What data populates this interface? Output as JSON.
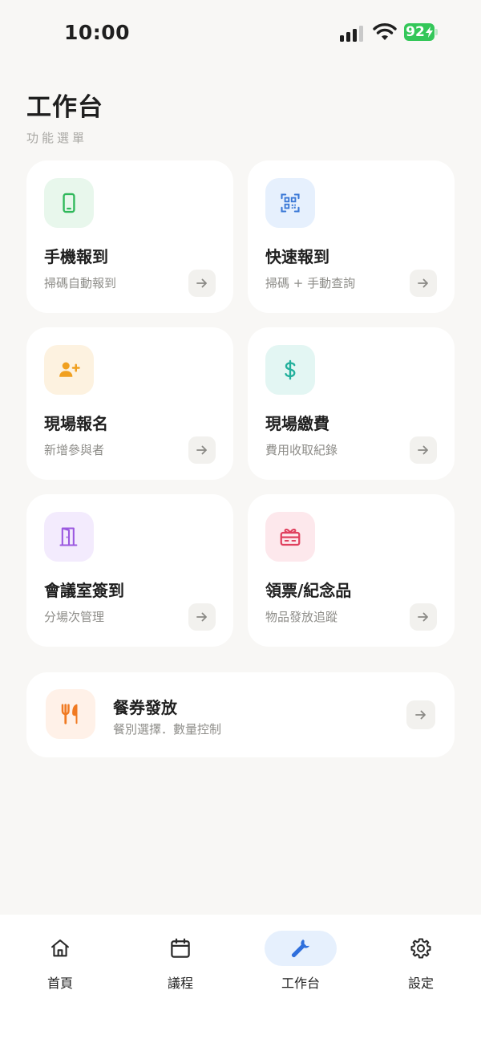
{
  "status_bar": {
    "time": "10:00",
    "battery": "92"
  },
  "header": {
    "title": "工作台",
    "subtitle": "功能選單"
  },
  "cards": [
    {
      "title": "手機報到",
      "description": "掃碼自動報到",
      "icon": "smartphone-icon",
      "color": "#2fb85a",
      "bg": "#e8f7ec"
    },
    {
      "title": "快速報到",
      "description": "掃碼 + 手動查詢",
      "icon": "qr-code-icon",
      "color": "#3a78d6",
      "bg": "#e6f0fd"
    },
    {
      "title": "現場報名",
      "description": "新增參與者",
      "icon": "add-user-icon",
      "color": "#f0a020",
      "bg": "#fdf2e0"
    },
    {
      "title": "現場繳費",
      "description": "費用收取紀錄",
      "icon": "dollar-icon",
      "color": "#22b09c",
      "bg": "#e3f6f3"
    },
    {
      "title": "會議室簽到",
      "description": "分場次管理",
      "icon": "door-icon",
      "color": "#9b59e0",
      "bg": "#f3ebfd"
    },
    {
      "title": "領票/紀念品",
      "description": "物品發放追蹤",
      "icon": "gift-icon",
      "color": "#e0405e",
      "bg": "#fde8ec"
    }
  ],
  "wide_card": {
    "title": "餐券發放",
    "description": "餐別選擇．數量控制",
    "icon": "utensils-icon",
    "color": "#f07a22",
    "bg": "#fff1e8"
  },
  "bottom_nav": [
    {
      "label": "首頁",
      "icon": "home-icon",
      "active": false
    },
    {
      "label": "議程",
      "icon": "calendar-icon",
      "active": false
    },
    {
      "label": "工作台",
      "icon": "wrench-icon",
      "active": true
    },
    {
      "label": "設定",
      "icon": "gear-icon",
      "active": false
    }
  ],
  "colors": {
    "background": "#f8f7f5",
    "accent": "#3a78d6",
    "battery": "#34c759"
  }
}
